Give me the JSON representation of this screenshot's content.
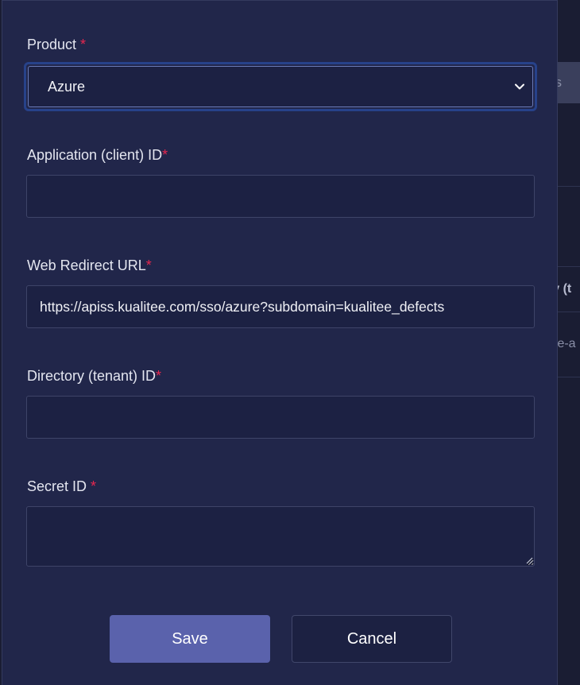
{
  "background": {
    "partial_texts": [
      "es",
      "ry (t",
      "iae-a"
    ]
  },
  "form": {
    "product": {
      "label": "Product ",
      "required_mark": "*",
      "selected_value": "Azure"
    },
    "application_client_id": {
      "label": "Application (client) ID",
      "required_mark": "*",
      "value": ""
    },
    "web_redirect_url": {
      "label": "Web Redirect URL",
      "required_mark": "*",
      "value": "https://apiss.kualitee.com/sso/azure?subdomain=kualitee_defects"
    },
    "directory_tenant_id": {
      "label": "Directory (tenant) ID",
      "required_mark": "*",
      "value": ""
    },
    "secret_id": {
      "label": "Secret ID ",
      "required_mark": "*",
      "value": ""
    }
  },
  "buttons": {
    "save_label": "Save",
    "cancel_label": "Cancel"
  },
  "colors": {
    "panel": "#21264a",
    "input": "#1c2143",
    "required": "#e8264f",
    "save_button": "#5a62ac",
    "focus_ring": "#27428a"
  },
  "icons": {
    "select_arrow": "chevron-down-icon",
    "textarea_grip": "resize-grip-icon"
  }
}
